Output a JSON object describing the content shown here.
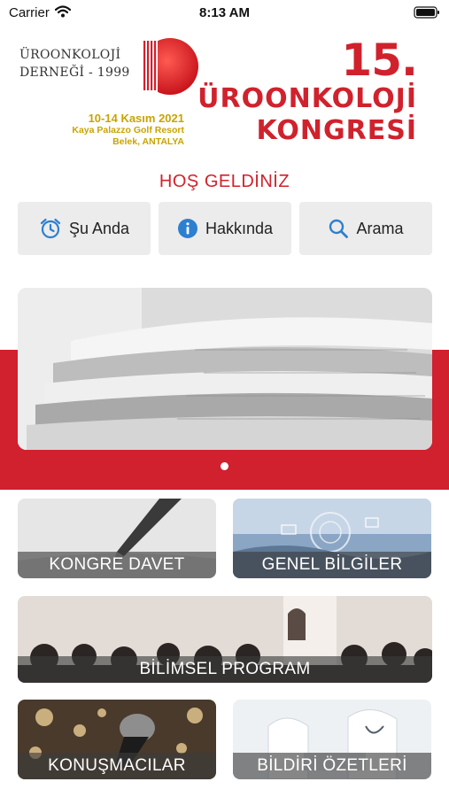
{
  "status_bar": {
    "carrier": "Carrier",
    "time": "8:13 AM",
    "wifi_icon": "wifi-icon",
    "battery_icon": "battery-icon"
  },
  "header": {
    "association_line1": "ÜROONKOLOJİ",
    "association_line2": "DERNEĞİ - 1999",
    "event_date": "10-14 Kasım 2021",
    "event_venue": "Kaya Palazzo Golf Resort",
    "event_city": "Belek, ANTALYA",
    "congress_number": "15.",
    "congress_line1": "ÜROONKOLOJİ",
    "congress_line2": "KONGRESİ"
  },
  "welcome": "HOŞ GELDİNİZ",
  "quick_actions": [
    {
      "label": "Şu Anda",
      "icon": "alarm-clock-icon"
    },
    {
      "label": "Hakkında",
      "icon": "info-icon"
    },
    {
      "label": "Arama",
      "icon": "search-icon"
    }
  ],
  "banner": {
    "image": "newspapers-photo",
    "active_page": 1,
    "page_count": 1
  },
  "tiles": [
    {
      "label": "KONGRE DAVET",
      "image": "fountain-pen-photo"
    },
    {
      "label": "GENEL BİLGİLER",
      "image": "digital-hands-photo"
    },
    {
      "label": "BİLİMSEL PROGRAM",
      "image": "audience-photo"
    },
    {
      "label": "KONUŞMACILAR",
      "image": "microphone-photo"
    },
    {
      "label": "BİLDİRİ ÖZETLERİ",
      "image": "doctors-photo"
    }
  ],
  "colors": {
    "brand_red": "#d1202e",
    "gold": "#c8a400",
    "button_gray": "#ececec",
    "icon_blue": "#2d7fd0"
  }
}
